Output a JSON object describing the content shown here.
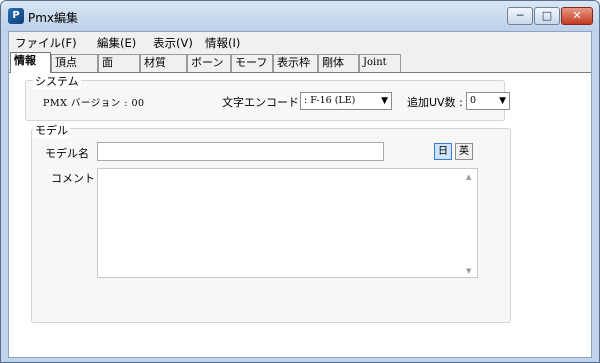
{
  "window": {
    "title": "Pmx編集",
    "icon": "pmx-app-icon"
  },
  "controls": {
    "minimize": "─",
    "maximize": "□",
    "close": "✕"
  },
  "menu": [
    "ファイル(F)",
    "編集(E)",
    "表示(V)",
    "情報(I)"
  ],
  "tabs": [
    "情報",
    "頂点",
    "面",
    "材質",
    "ボーン",
    "モーフ",
    "表示枠",
    "剛体",
    "Joint"
  ],
  "active_tab": "情報",
  "system_group": {
    "title": "システム",
    "pmx_version_label": "PMX バージョン : 00",
    "encode_label": "文字エンコード",
    "encode_value": ": F-16 (LE)",
    "uv_label": "追加UV数 :",
    "uv_value": "0"
  },
  "model_group": {
    "title": "モデル",
    "name_label": "モデル名",
    "name_value": "",
    "comment_label": "コメント",
    "comment_value": "",
    "lang_jp": "日",
    "lang_en": "英"
  }
}
